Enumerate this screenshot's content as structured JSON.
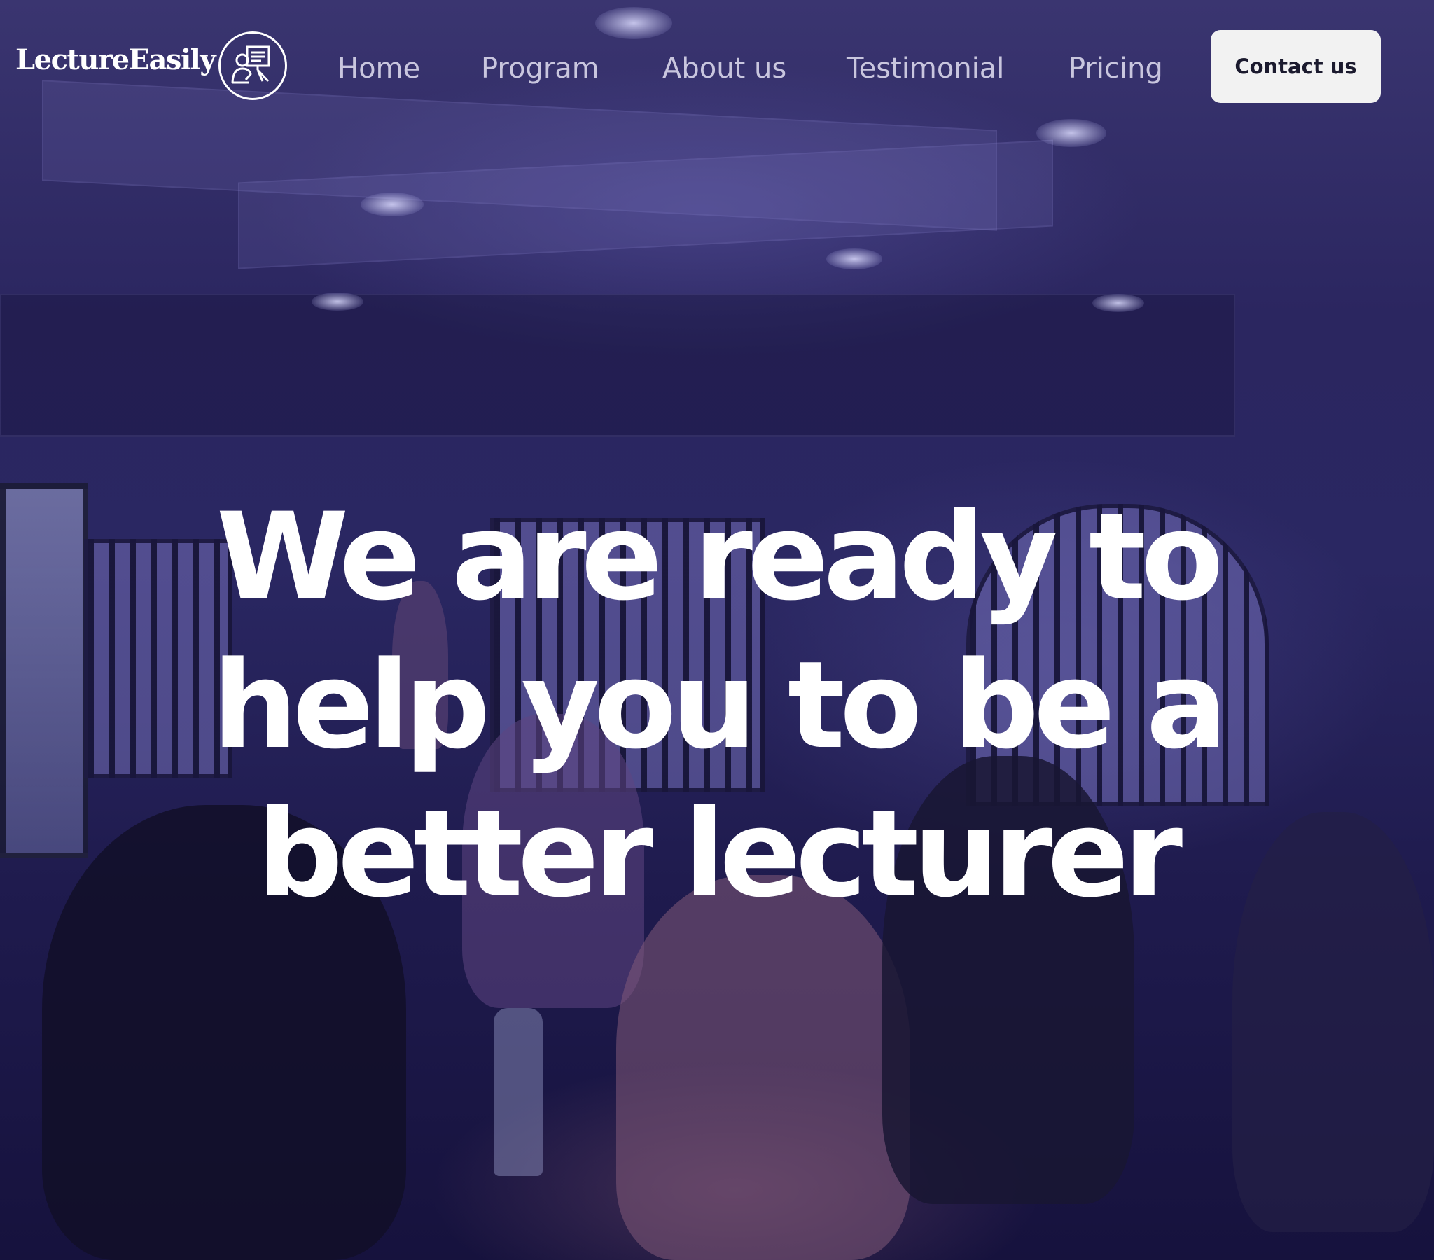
{
  "brand": {
    "name": "LectureEasily",
    "icon": "presentation-icon"
  },
  "nav": {
    "items": [
      {
        "label": "Home"
      },
      {
        "label": "Program"
      },
      {
        "label": "About us"
      },
      {
        "label": "Testimonial"
      },
      {
        "label": "Pricing"
      }
    ],
    "contact_label": "Contact us"
  },
  "hero": {
    "headline_lines": [
      "We are ready to",
      "help you to be a",
      "better lecturer"
    ],
    "background": "classroom-photo"
  },
  "colors": {
    "overlay": "#2a2762",
    "nav_text": "#c9c6de",
    "headline": "#ffffff",
    "button_bg": "#f2f2f2",
    "button_text": "#1b1a2e"
  }
}
